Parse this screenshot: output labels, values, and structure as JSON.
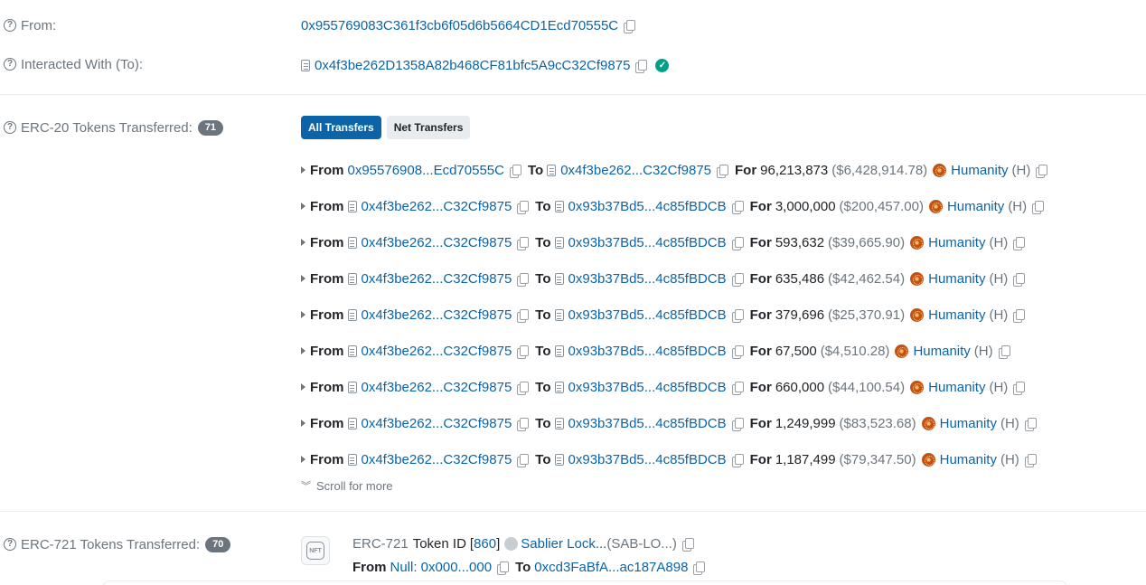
{
  "from": {
    "label": "From:",
    "address": "0x955769083C361f3cb6f05d6b5664CD1Ecd70555C"
  },
  "interacted_with": {
    "label": "Interacted With (To):",
    "address": "0x4f3be262D1358A82b468CF81bfc5A9cC32Cf9875"
  },
  "erc20": {
    "label": "ERC-20 Tokens Transferred:",
    "count": "71",
    "tabs": [
      "All Transfers",
      "Net Transfers"
    ],
    "from_kw": "From",
    "to_kw": "To",
    "for_kw": "For",
    "transfers": [
      {
        "from": "0x95576908...Ecd70555C",
        "from_contract": false,
        "to": "0x4f3be262...C32Cf9875",
        "amount": "96,213,873",
        "usd": "($6,428,914.78)",
        "token": "Humanity",
        "symbol": "(H)"
      },
      {
        "from": "0x4f3be262...C32Cf9875",
        "from_contract": true,
        "to": "0x93b37Bd5...4c85fBDCB",
        "amount": "3,000,000",
        "usd": "($200,457.00)",
        "token": "Humanity",
        "symbol": "(H)"
      },
      {
        "from": "0x4f3be262...C32Cf9875",
        "from_contract": true,
        "to": "0x93b37Bd5...4c85fBDCB",
        "amount": "593,632",
        "usd": "($39,665.90)",
        "token": "Humanity",
        "symbol": "(H)"
      },
      {
        "from": "0x4f3be262...C32Cf9875",
        "from_contract": true,
        "to": "0x93b37Bd5...4c85fBDCB",
        "amount": "635,486",
        "usd": "($42,462.54)",
        "token": "Humanity",
        "symbol": "(H)"
      },
      {
        "from": "0x4f3be262...C32Cf9875",
        "from_contract": true,
        "to": "0x93b37Bd5...4c85fBDCB",
        "amount": "379,696",
        "usd": "($25,370.91)",
        "token": "Humanity",
        "symbol": "(H)"
      },
      {
        "from": "0x4f3be262...C32Cf9875",
        "from_contract": true,
        "to": "0x93b37Bd5...4c85fBDCB",
        "amount": "67,500",
        "usd": "($4,510.28)",
        "token": "Humanity",
        "symbol": "(H)"
      },
      {
        "from": "0x4f3be262...C32Cf9875",
        "from_contract": true,
        "to": "0x93b37Bd5...4c85fBDCB",
        "amount": "660,000",
        "usd": "($44,100.54)",
        "token": "Humanity",
        "symbol": "(H)"
      },
      {
        "from": "0x4f3be262...C32Cf9875",
        "from_contract": true,
        "to": "0x93b37Bd5...4c85fBDCB",
        "amount": "1,249,999",
        "usd": "($83,523.68)",
        "token": "Humanity",
        "symbol": "(H)"
      },
      {
        "from": "0x4f3be262...C32Cf9875",
        "from_contract": true,
        "to": "0x93b37Bd5...4c85fBDCB",
        "amount": "1,187,499",
        "usd": "($79,347.50)",
        "token": "Humanity",
        "symbol": "(H)"
      }
    ],
    "scroll_more": "Scroll for more"
  },
  "erc721": {
    "label": "ERC-721 Tokens Transferred:",
    "count": "70",
    "nft_icon_text": "NFT",
    "standard": "ERC-721",
    "token_id_kw": "Token ID",
    "token_id_open": "[",
    "token_id": "860",
    "token_id_close": "]",
    "collection": "Sablier Lock...",
    "collection_symbol": "(SAB-LO...)",
    "from_kw": "From",
    "from": "Null: 0x000...000",
    "to_kw": "To",
    "to": "0xcd3FaBfA...ac187A898"
  },
  "colors": {
    "link": "#0b64a8",
    "muted": "#6c757d",
    "verified": "#00a186",
    "token_icon": "#c4520f"
  }
}
